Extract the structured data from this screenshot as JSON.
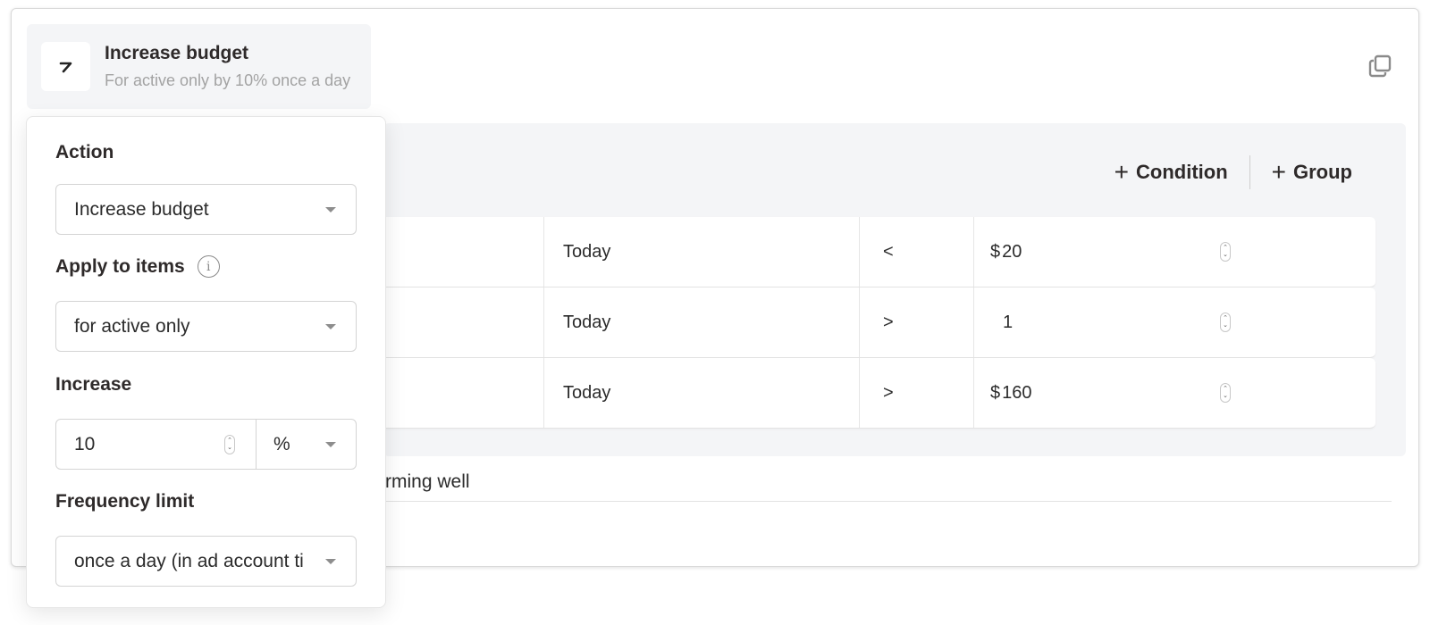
{
  "rule": {
    "title": "Increase budget",
    "subtitle": "For active only by 10% once a day",
    "icon": "arrow-up-right-icon",
    "copy_icon": "copy-icon"
  },
  "conditions_panel": {
    "add_condition_label": "Condition",
    "add_group_label": "Group",
    "rows": [
      {
        "period": "Today",
        "operator": "<",
        "currency": "$",
        "value": "20"
      },
      {
        "period": "Today",
        "operator": ">",
        "currency": "",
        "value": "1"
      },
      {
        "period": "Today",
        "operator": ">",
        "currency": "$",
        "value": "160"
      }
    ]
  },
  "description_fragment": "rming well",
  "popover": {
    "action_label": "Action",
    "action_value": "Increase budget",
    "apply_label": "Apply to items",
    "apply_value": "for active only",
    "increase_label": "Increase",
    "increase_value": "10",
    "increase_unit": "%",
    "frequency_label": "Frequency limit",
    "frequency_value": "once a day (in ad account ti"
  }
}
